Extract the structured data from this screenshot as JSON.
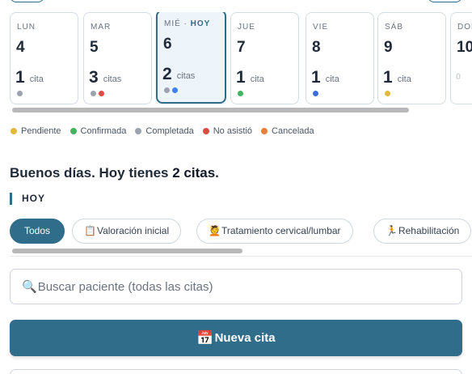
{
  "calendar": {
    "days": [
      {
        "name": "LUN",
        "today_label": "",
        "num": "4",
        "count": "1",
        "unit": "cita",
        "dots": [
          "#9ca3af"
        ]
      },
      {
        "name": "MAR",
        "today_label": "",
        "num": "5",
        "count": "3",
        "unit": "citas",
        "dots": [
          "#9ca3af",
          "#dc4c43"
        ]
      },
      {
        "name": "MIÉ · ",
        "today_label": "HOY",
        "num": "6",
        "count": "2",
        "unit": "citas",
        "dots": [
          "#9ca3af",
          "#3b82f6"
        ]
      },
      {
        "name": "JUE",
        "today_label": "",
        "num": "7",
        "count": "1",
        "unit": "cita",
        "dots": [
          "#43b360"
        ]
      },
      {
        "name": "VIE",
        "today_label": "",
        "num": "8",
        "count": "1",
        "unit": "cita",
        "dots": [
          "#3b6fd6"
        ]
      },
      {
        "name": "SÁB",
        "today_label": "",
        "num": "9",
        "count": "1",
        "unit": "cita",
        "dots": [
          "#e2b93b"
        ]
      },
      {
        "name": "DOM",
        "today_label": "",
        "num": "10",
        "count": "0",
        "unit": "",
        "dots": []
      }
    ],
    "today_index": 2,
    "scroll_fraction": 0.86
  },
  "legend": [
    {
      "label": "Pendiente",
      "color": "#e2b93b"
    },
    {
      "label": "Confirmada",
      "color": "#43b360"
    },
    {
      "label": "Completada",
      "color": "#9ca3af"
    },
    {
      "label": "No asistió",
      "color": "#dc4c43"
    },
    {
      "label": "Cancelada",
      "color": "#ef7d3a"
    }
  ],
  "greeting": {
    "prefix": "Buenos días. Hoy tienes ",
    "count": "2 citas",
    "suffix": "."
  },
  "section": {
    "title": "HOY"
  },
  "filters": [
    {
      "icon": "",
      "label": "Todos",
      "active": true
    },
    {
      "icon": "📋",
      "label": "Valoración inicial",
      "active": false
    },
    {
      "icon": "💆",
      "label": "Tratamiento cervical/lumbar",
      "active": false
    },
    {
      "icon": "🏃",
      "label": "Rehabilitación",
      "active": false
    }
  ],
  "search": {
    "icon": "🔍",
    "placeholder": "Buscar paciente (todas las citas)"
  },
  "new_button": {
    "icon": "📅",
    "label": "Nueva cita"
  },
  "colors": {
    "accent": "#2f6d8a"
  }
}
